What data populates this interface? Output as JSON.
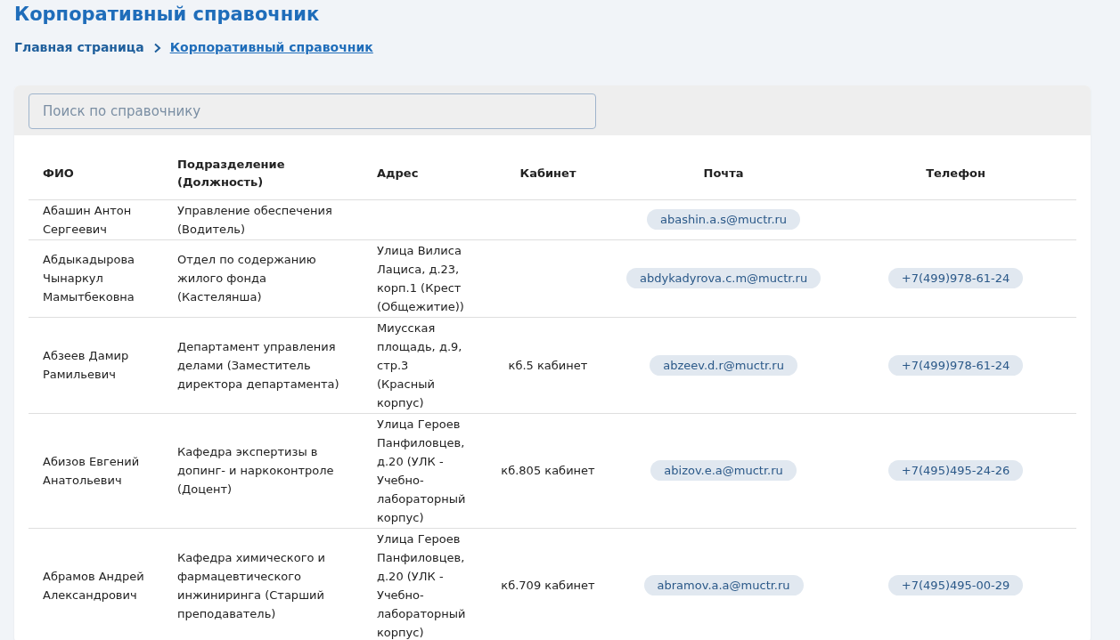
{
  "title": "Корпоративный справочник",
  "breadcrumbs": [
    {
      "label": "Главная страница",
      "current": false
    },
    {
      "label": "Корпоративный справочник",
      "current": true
    }
  ],
  "search": {
    "placeholder": "Поиск по справочнику"
  },
  "table": {
    "columns": [
      "ФИО",
      "Подразделение (Должность)",
      "Адрес",
      "Кабинет",
      "Почта",
      "Телефон"
    ],
    "rows": [
      {
        "name": "Абашин Антон Сергеевич",
        "department": "Управление обеспечения (Водитель)",
        "email": "abashin.a.s@muctr.ru"
      },
      {
        "name": "Абдыкадырова Чынаркул Мамытбековна",
        "department": "Отдел по содержанию жилого фонда (Кастелянша)",
        "address": "Улица Вилиса Лациса, д.23, корп.1 (Крест (Общежитие))",
        "email": "abdykadyrova.c.m@muctr.ru",
        "phone": "+7(499)978-61-24"
      },
      {
        "name": "Абзеев Дамир Рамильевич",
        "department": "Департамент управления делами (Заместитель директора департамента)",
        "address": "Миусская площадь, д.9, стр.3 (Красный корпус)",
        "room": "кб.5 кабинет",
        "email": "abzeev.d.r@muctr.ru",
        "phone": "+7(499)978-61-24"
      },
      {
        "name": "Абизов Евгений Анатольевич",
        "department": "Кафедра экспертизы в допинг- и наркоконтроле (Доцент)",
        "address": "Улица Героев Панфиловцев, д.20 (УЛК - Учебно-лабораторный корпус)",
        "room": "кб.805 кабинет",
        "email": "abizov.e.a@muctr.ru",
        "phone": "+7(495)495-24-26"
      },
      {
        "name": "Абрамов Андрей Александрович",
        "department": "Кафедра химического и фармацевтического инжиниринга (Старший преподаватель)",
        "address": "Улица Героев Панфиловцев, д.20 (УЛК - Учебно-лабораторный корпус)",
        "room": "кб.709 кабинет",
        "email": "abramov.a.a@muctr.ru",
        "phone": "+7(495)495-00-29"
      }
    ]
  }
}
